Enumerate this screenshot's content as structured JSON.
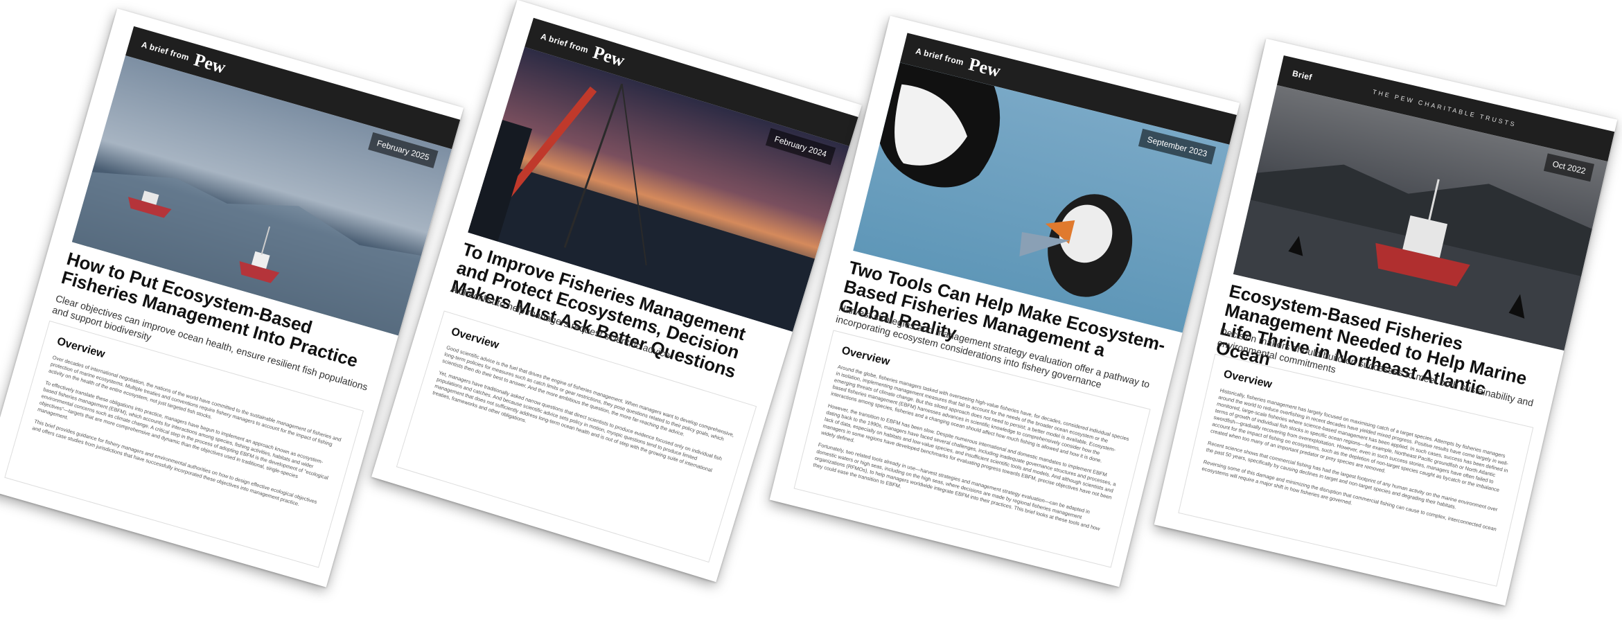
{
  "briefs": [
    {
      "header_label": "A brief from",
      "brand": "Pew",
      "date": "February 2025",
      "title": "How to Put Ecosystem-Based Fisheries Management Into Practice",
      "subtitle": "Clear objectives can improve ocean health, ensure resilient fish populations and support biodiversity",
      "overview_heading": "Overview",
      "paragraphs": [
        "Over decades of international negotiation, the nations of the world have committed to the sustainable management of fisheries and protection of marine ecosystems. Multiple treaties and conventions require fishery managers to account for the impact of fishing activity on the health of the entire ecosystem, not just targeted fish stocks.",
        "To effectively translate these obligations into practice, managers have begun to implement an approach known as ecosystem-based fisheries management (EBFM), which accounts for interactions among species, fishing activities, habitats and wider environmental concerns such as climate change. A critical step in the process of adopting EBFM is the development of \"ecological objectives\"—targets that are more comprehensive and dynamic than the objectives used in traditional, single-species management.",
        "This brief provides guidance for fishery managers and environmental authorities on how to design effective ecological objectives and offers case studies from jurisdictions that have successfully incorporated these objectives into management practice."
      ]
    },
    {
      "header_label": "A brief from",
      "brand": "Pew",
      "date": "February 2024",
      "title": "To Improve Fisheries Management and Protect Ecosystems, Decision Makers Must Ask Better Questions",
      "subtitle": "A checklist to help managers request scientific advice",
      "overview_heading": "Overview",
      "paragraphs": [
        "Good scientific advice is the fuel that drives the engine of fisheries management. When managers want to develop comprehensive, long-term policies for measures such as catch limits or gear restrictions, they pose questions related to their policy goals, which scientists then do their best to answer. And the more ambitious the question, the more far-reaching the advice.",
        "Yet, managers have traditionally asked narrow questions that direct scientists to produce evidence focused only on individual fish populations and catches. And because scientific advice sets policy in motion, myopic questions tend to produce limited management that does not sufficiently address long-term ocean health and is out of step with the growing suite of international treaties, frameworks and other obligations."
      ]
    },
    {
      "header_label": "A brief from",
      "brand": "Pew",
      "date": "September 2023",
      "title": "Two Tools Can Help Make Ecosystem-Based Fisheries Management a Global Reality",
      "subtitle": "Harvest strategies and management strategy evaluation offer a pathway to incorporating ecosystem considerations into fishery governance",
      "overview_heading": "Overview",
      "paragraphs": [
        "Around the globe, fisheries managers tasked with overseeing high-value fisheries have, for decades, considered individual species in isolation, implementing management measures that fail to account for the needs of the broader ocean ecosystem or the emerging threats of climate change. But this siloed approach does not need to persist; a better model is available. Ecosystem-based fisheries management (EBFM) harnesses advances in scientific knowledge to comprehensively consider how the interactions among species, fisheries and a changing ocean should affect how much fishing is allowed and how it is done.",
        "However, the transition to EBFM has been slow. Despite numerous international and domestic mandates to implement EBFM dating back to the 1990s, managers have faced several challenges, including inadequate governance structures and processes, a lack of data, especially on habitats and low-value species, and insufficient scientific tools and models. And although scientists and managers in some regions have developed benchmarks for evaluating progress towards EBFM, precise objectives have not been widely defined.",
        "Fortunately, two related tools already in use—harvest strategies and management strategy evaluation—can be adapted in domestic waters or high seas, including on the high seas, where decisions are made by regional fisheries management organizations (RFMOs), to help managers worldwide integrate EBFM into their practices. This brief looks at these tools and how they could ease the transition to EBFM."
      ]
    },
    {
      "header_label": "Brief",
      "brand": "THE PEW CHARITABLE TRUSTS",
      "date": "Oct 2022",
      "title": "Ecosystem-Based Fisheries Management Needed to Help Marine Life Thrive in Northeast Atlantic Ocean",
      "subtitle": "Decision makers should build on successes to meet both sustainability and environmental commitments",
      "overview_heading": "Overview",
      "paragraphs": [
        "Historically, fisheries management has largely focused on maximising catch of a target species. Attempts by fisheries managers around the world to reduce overfishing in recent decades have yielded mixed progress. Positive results have come largely in well-monitored, large-scale fisheries where science-based management has been applied. In such cases, success has been defined in terms of growth of individual fish stocks in specific ocean regions—for example, Northeast Pacific groundfish or North Atlantic swordfish—gradually recovering from overexploitation. However, even in such success stories, managers have often failed to account for the impact of fishing on ecosystems, such as the depletion of non-target species caught as bycatch or the imbalance created when too many of an important predator or prey species are removed.",
        "Recent science shows that commercial fishing has had the largest footprint of any human activity on the marine environment over the past 50 years, specifically by causing declines in target and non-target species and degrading their habitats.",
        "Reversing some of this damage and minimizing the disruption that commercial fishing can cause to complex, interconnected ocean ecosystems will require a major shift in how fisheries are governed."
      ]
    }
  ]
}
